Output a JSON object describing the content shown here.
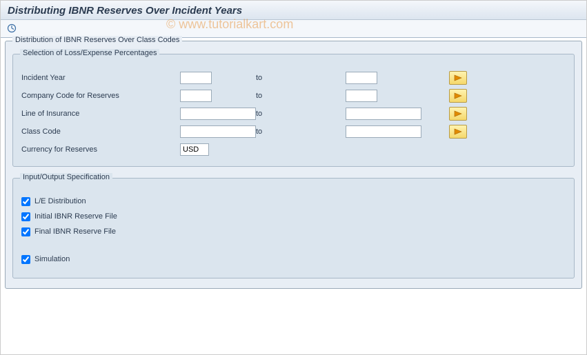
{
  "title": "Distributing IBNR Reserves Over Incident Years",
  "watermark": "© www.tutorialkart.com",
  "outer_group": {
    "legend": "Distribution of IBNR Reserves Over Class Codes"
  },
  "selection": {
    "legend": "Selection of Loss/Expense Percentages",
    "rows": {
      "incident_year": {
        "label": "Incident Year",
        "from": "",
        "to_label": "to",
        "to": ""
      },
      "company_code": {
        "label": "Company Code for Reserves",
        "from": "",
        "to_label": "to",
        "to": ""
      },
      "line_insurance": {
        "label": "Line of Insurance",
        "from": "",
        "to_label": "to",
        "to": ""
      },
      "class_code": {
        "label": "Class Code",
        "from": "",
        "to_label": "to",
        "to": ""
      },
      "currency": {
        "label": "Currency for Reserves",
        "value": "USD"
      }
    }
  },
  "io_spec": {
    "legend": "Input/Output Specification",
    "le_distribution": {
      "label": "L/E Distribution",
      "checked": true
    },
    "initial_ibnr": {
      "label": "Initial IBNR Reserve File",
      "checked": true
    },
    "final_ibnr": {
      "label": "Final IBNR Reserve File",
      "checked": true
    },
    "simulation": {
      "label": "Simulation",
      "checked": true
    }
  }
}
